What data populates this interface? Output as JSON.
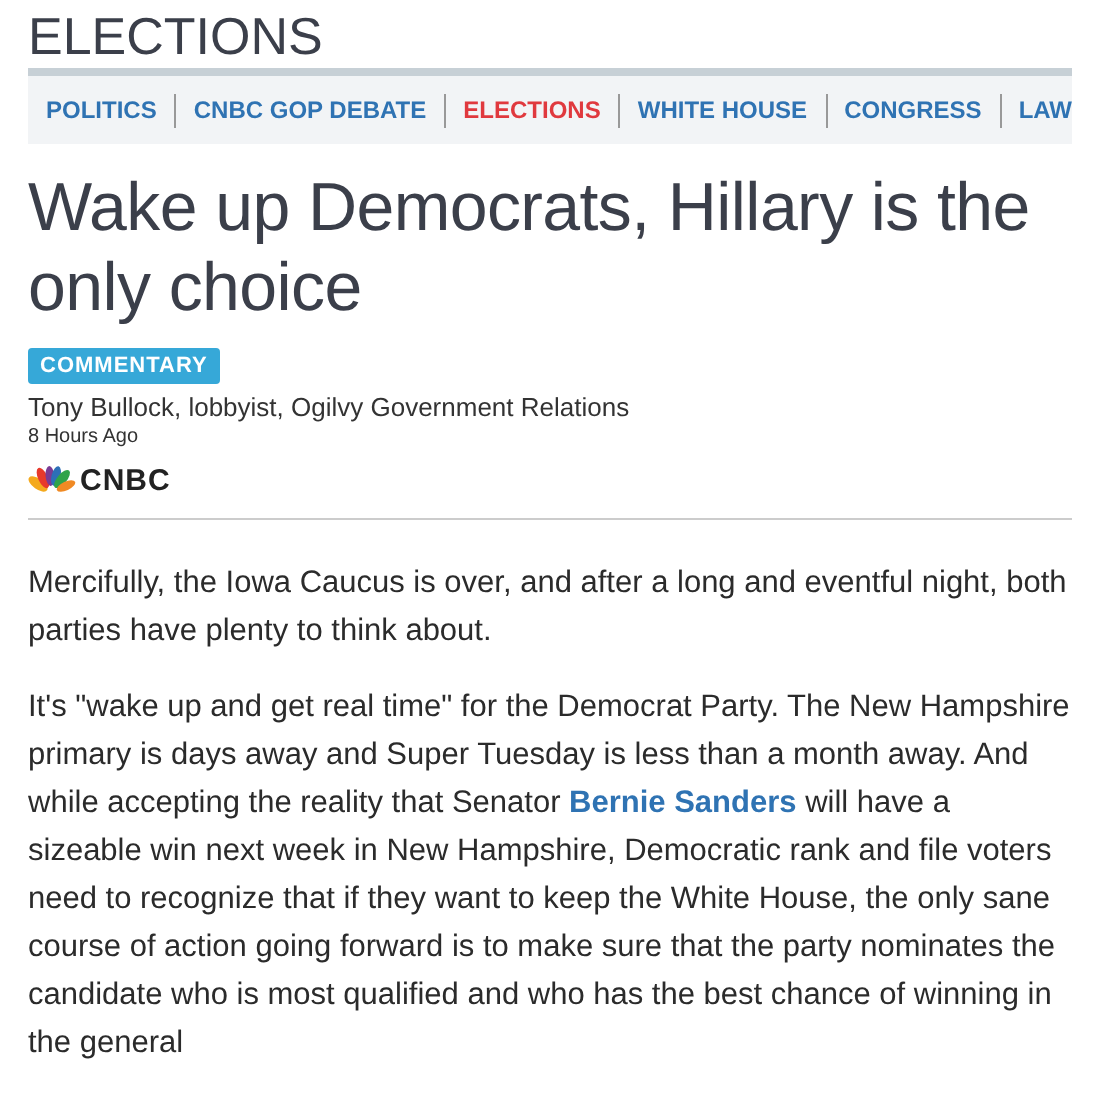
{
  "section": {
    "title": "ELECTIONS"
  },
  "nav": [
    {
      "label": "POLITICS",
      "selected": false
    },
    {
      "label": "CNBC GOP DEBATE",
      "selected": false
    },
    {
      "label": "ELECTIONS",
      "selected": true
    },
    {
      "label": "WHITE HOUSE",
      "selected": false
    },
    {
      "label": "CONGRESS",
      "selected": false
    },
    {
      "label": "LAW",
      "selected": false
    }
  ],
  "article": {
    "headline": "Wake up Democrats, Hillary is the only choice",
    "tag": "COMMENTARY",
    "byline": "Tony Bullock, lobbyist, Ogilvy Government Relations",
    "time": "8 Hours Ago",
    "source": "CNBC",
    "paragraphs": [
      [
        {
          "kind": "text",
          "text": "Mercifully, the Iowa Caucus is over, and after a long and eventful night, both parties have plenty to think about."
        }
      ],
      [
        {
          "kind": "text",
          "text": "It's \"wake up and get real time\" for the Democrat Party. The New Hampshire primary is days away and Super Tuesday is less than a month away. And while accepting the reality that Senator "
        },
        {
          "kind": "link",
          "text": "Bernie Sanders"
        },
        {
          "kind": "text",
          "text": " will have a sizeable win next week in New Hampshire, Democratic rank and file voters need to recognize that if they want to keep the White House, the only sane course of action going forward is to make sure that the party nominates the candidate who is most qualified and who has the best chance of winning in the general"
        }
      ]
    ]
  }
}
